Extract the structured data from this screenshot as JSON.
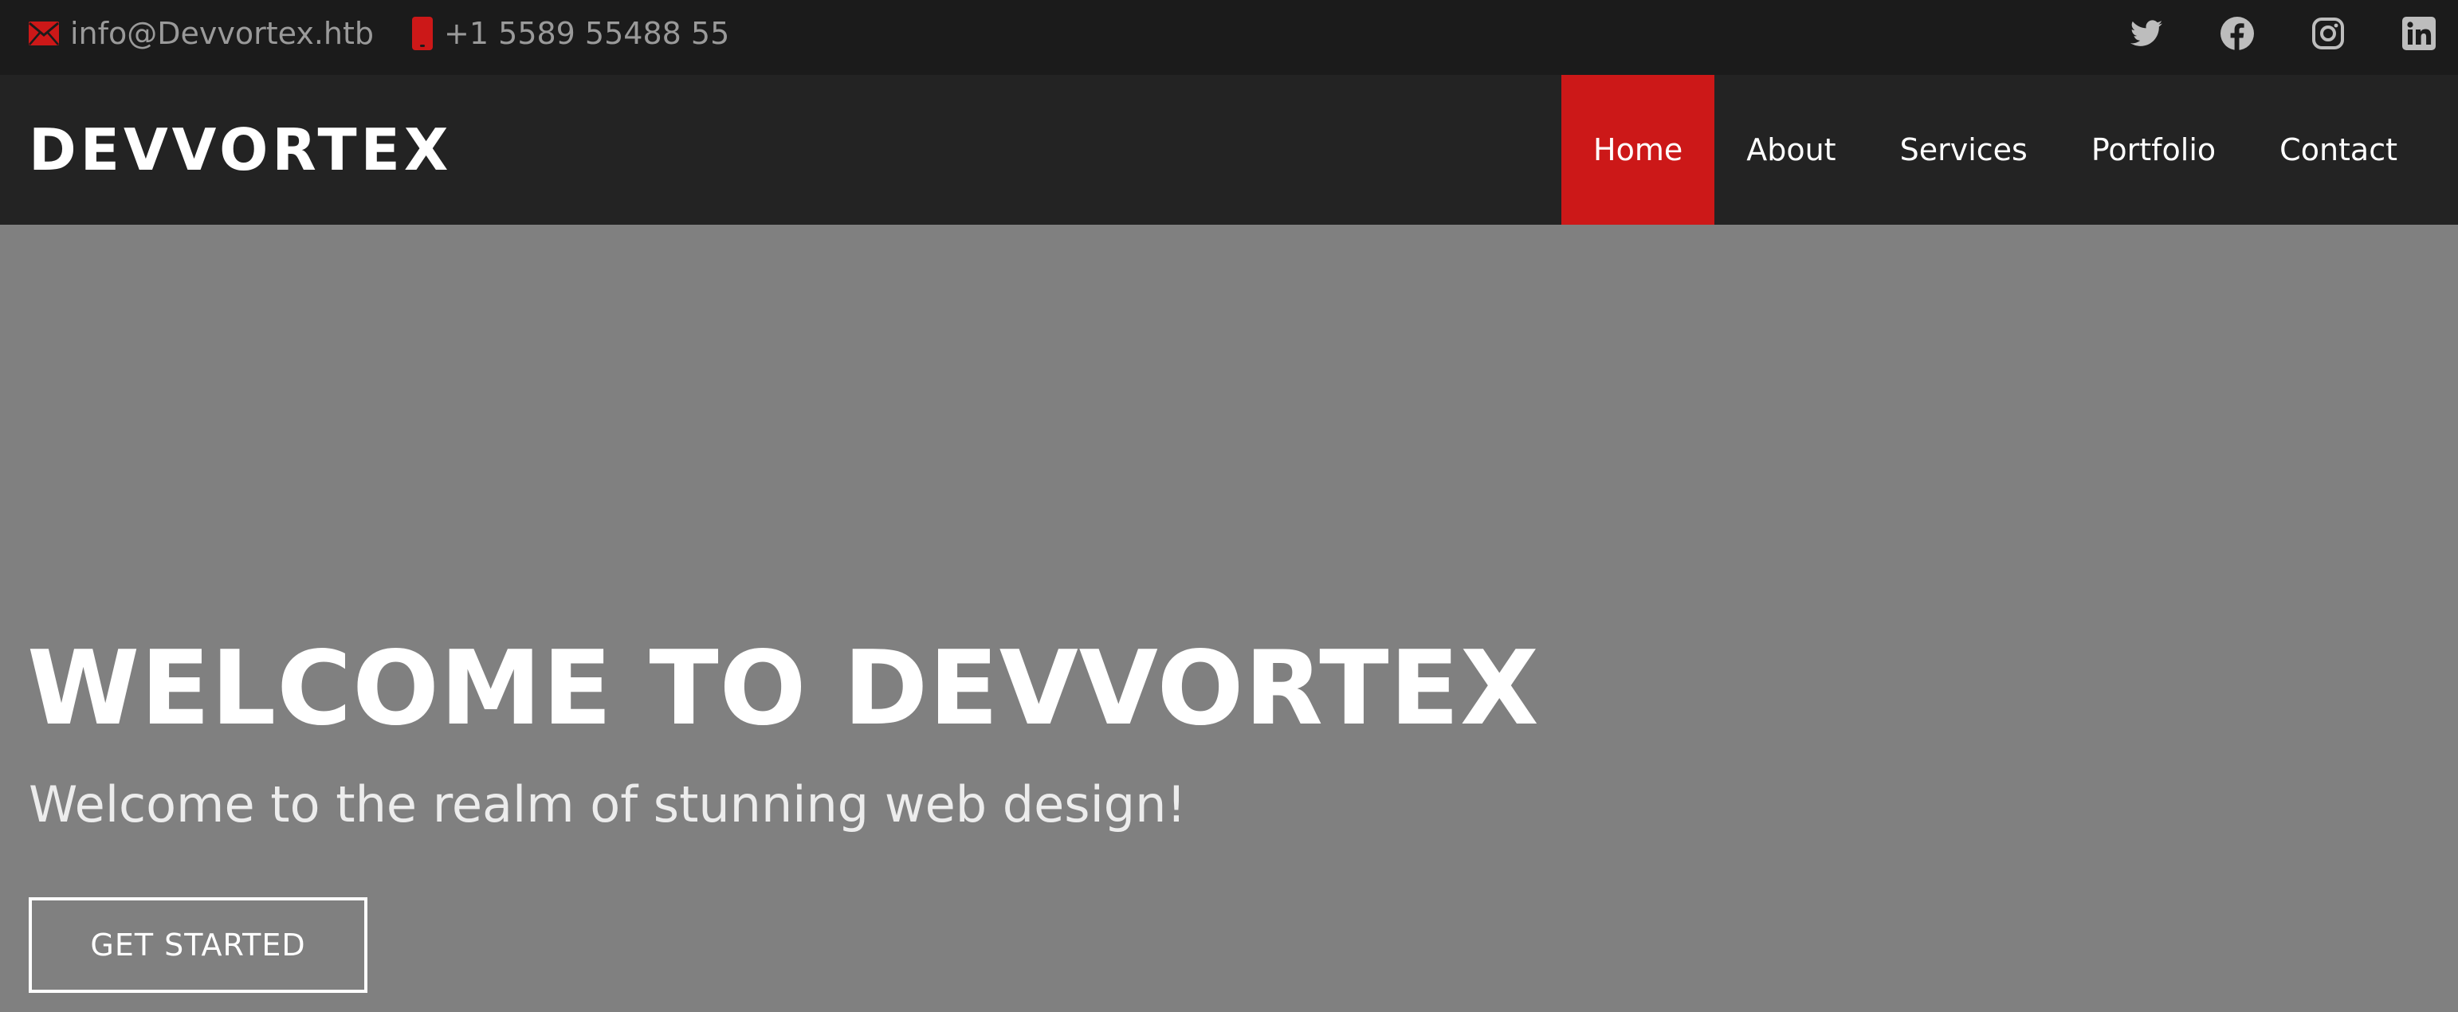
{
  "topbar": {
    "email": "info@Devvortex.htb",
    "phone": "+1 5589 55488 55",
    "email_icon": "envelope-icon",
    "phone_icon": "phone-icon",
    "socials": [
      "twitter-icon",
      "facebook-icon",
      "instagram-icon",
      "linkedin-icon"
    ]
  },
  "header": {
    "logo": "DEVVORTEX",
    "nav": [
      {
        "label": "Home",
        "active": true
      },
      {
        "label": "About",
        "active": false
      },
      {
        "label": "Services",
        "active": false
      },
      {
        "label": "Portfolio",
        "active": false
      },
      {
        "label": "Contact",
        "active": false
      }
    ]
  },
  "hero": {
    "title": "WELCOME TO DEVVORTEX",
    "subtitle": "Welcome to the realm of stunning web design!",
    "cta_label": "GET STARTED"
  },
  "colors": {
    "accent": "#cc1818",
    "topbar_bg": "#1b1b1b",
    "header_bg": "#232323",
    "hero_bg": "#808080"
  }
}
